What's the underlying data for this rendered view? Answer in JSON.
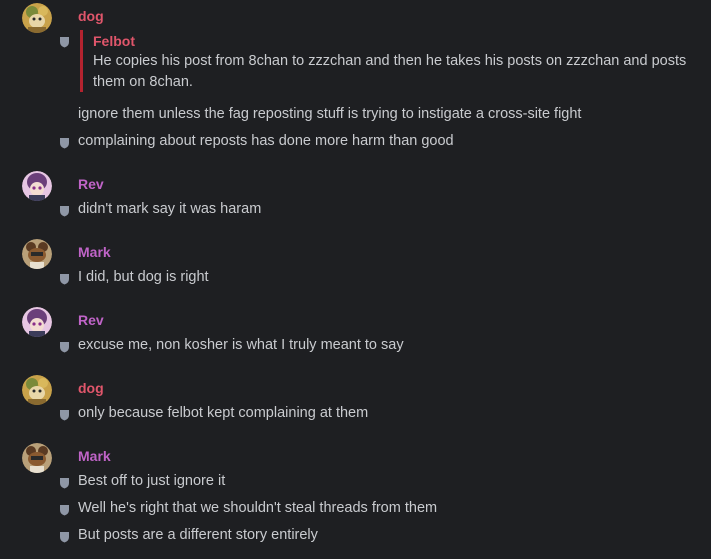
{
  "colors": {
    "background": "#1e1f22",
    "text": "#c9cbcf",
    "dog": "#e0566b",
    "rev": "#c064c8",
    "mark": "#c064c8",
    "quote_border": "#b4232f",
    "badge": "#8f97a6"
  },
  "messages": [
    {
      "author": "dog",
      "avatar": "dog-avatar",
      "quote": {
        "author": "Felbot",
        "text": "He copies his post from 8chan to zzzchan and then he takes his posts on zzzchan and posts them on 8chan."
      },
      "lines": [
        "ignore them unless the fag reposting stuff is trying to instigate a cross-site fight",
        "complaining about reposts has done more harm than good"
      ]
    },
    {
      "author": "Rev",
      "avatar": "rev-avatar",
      "lines": [
        "didn't mark say it was haram"
      ]
    },
    {
      "author": "Mark",
      "avatar": "mark-avatar",
      "lines": [
        "I did, but dog is right"
      ]
    },
    {
      "author": "Rev",
      "avatar": "rev-avatar",
      "lines": [
        "excuse me, non kosher is what I truly meant to say"
      ]
    },
    {
      "author": "dog",
      "avatar": "dog-avatar",
      "lines": [
        "only because felbot kept complaining at them"
      ]
    },
    {
      "author": "Mark",
      "avatar": "mark-avatar",
      "lines": [
        "Best off to just ignore it",
        "Well he's right that we shouldn't steal threads from them",
        "But posts are a different story entirely"
      ]
    }
  ]
}
